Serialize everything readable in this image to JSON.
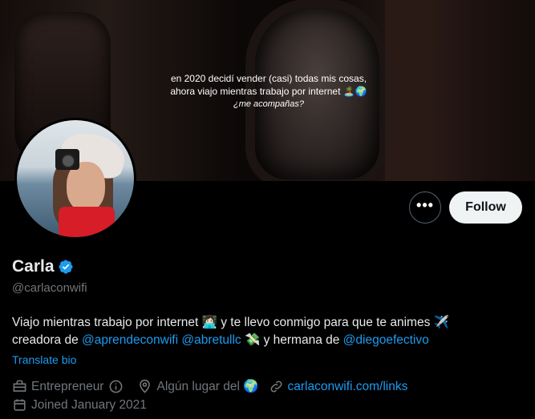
{
  "banner": {
    "line1": "en  2020 decidí vender (casi) todas mis cosas,",
    "line2": "ahora viajo mientras trabajo por internet 🏝️🌍",
    "line3": "¿me acompañas?"
  },
  "actions": {
    "more_label": "•••",
    "follow_label": "Follow"
  },
  "profile": {
    "name": "Carla",
    "handle": "@carlaconwifi",
    "bio_line1_a": "Viajo mientras trabajo por internet 👩🏻‍💻 y te llevo conmigo para que te animes ✈️",
    "bio_line2_a": "creadora de ",
    "mention1": "@aprendeconwifi",
    "bio_space": " ",
    "mention2": "@abretullc",
    "bio_line2_b": " 💸 y hermana de ",
    "mention3": "@diegoefectivo",
    "translate": "Translate bio",
    "category": "Entrepreneur",
    "location": "Algún lugar del 🌍",
    "website": "carlaconwifi.com/links",
    "joined": "Joined January 2021"
  },
  "colors": {
    "accent": "#1d9bf0",
    "muted": "#71767b",
    "text": "#e7e9ea",
    "follow_bg": "#eff3f4"
  },
  "icons": [
    "verified-badge-icon",
    "briefcase-icon",
    "info-icon",
    "location-pin-icon",
    "link-icon",
    "calendar-icon",
    "more-dots-icon"
  ]
}
